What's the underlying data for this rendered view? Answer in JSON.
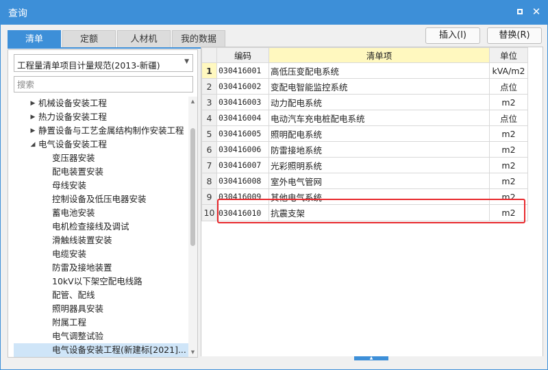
{
  "window": {
    "title": "查询"
  },
  "tabs": [
    {
      "label": "清单",
      "active": true
    },
    {
      "label": "定额",
      "active": false
    },
    {
      "label": "人材机",
      "active": false
    },
    {
      "label": "我的数据",
      "active": false
    }
  ],
  "toolbar": {
    "insert_label": "插入(I)",
    "replace_label": "替换(R)"
  },
  "left_panel": {
    "standard_select": "工程量清单项目计量规范(2013-新疆)",
    "search_placeholder": "搜索",
    "tree": [
      {
        "label": "机械设备安装工程",
        "level": 0,
        "expanded": false
      },
      {
        "label": "热力设备安装工程",
        "level": 0,
        "expanded": false
      },
      {
        "label": "静置设备与工艺金属结构制作安装工程",
        "level": 0,
        "expanded": false
      },
      {
        "label": "电气设备安装工程",
        "level": 0,
        "expanded": true
      },
      {
        "label": "变压器安装",
        "level": 1
      },
      {
        "label": "配电装置安装",
        "level": 1
      },
      {
        "label": "母线安装",
        "level": 1
      },
      {
        "label": "控制设备及低压电器安装",
        "level": 1
      },
      {
        "label": "蓄电池安装",
        "level": 1
      },
      {
        "label": "电机检查接线及调试",
        "level": 1
      },
      {
        "label": "滑触线装置安装",
        "level": 1
      },
      {
        "label": "电缆安装",
        "level": 1
      },
      {
        "label": "防雷及接地装置",
        "level": 1
      },
      {
        "label": "10kV以下架空配电线路",
        "level": 1
      },
      {
        "label": "配管、配线",
        "level": 1
      },
      {
        "label": "照明器具安装",
        "level": 1
      },
      {
        "label": "附属工程",
        "level": 1
      },
      {
        "label": "电气调整试验",
        "level": 1
      },
      {
        "label": "电气设备安装工程(新建标[2021]...",
        "level": 1,
        "selected": true
      },
      {
        "label": "建筑智能化工程",
        "level": 0,
        "expanded": false
      }
    ]
  },
  "grid": {
    "columns": [
      "编码",
      "清单项",
      "单位"
    ],
    "rows": [
      {
        "num": "1",
        "code": "030416001",
        "name": "高低压变配电系统",
        "unit": "kVA/m2",
        "current": true
      },
      {
        "num": "2",
        "code": "030416002",
        "name": "变配电智能监控系统",
        "unit": "点位"
      },
      {
        "num": "3",
        "code": "030416003",
        "name": "动力配电系统",
        "unit": "m2"
      },
      {
        "num": "4",
        "code": "030416004",
        "name": "电动汽车充电桩配电系统",
        "unit": "点位"
      },
      {
        "num": "5",
        "code": "030416005",
        "name": "照明配电系统",
        "unit": "m2"
      },
      {
        "num": "6",
        "code": "030416006",
        "name": "防雷接地系统",
        "unit": "m2"
      },
      {
        "num": "7",
        "code": "030416007",
        "name": "光彩照明系统",
        "unit": "m2"
      },
      {
        "num": "8",
        "code": "030416008",
        "name": "室外电气管网",
        "unit": "m2"
      },
      {
        "num": "9",
        "code": "030416009",
        "name": "其他电气系统",
        "unit": "m2"
      },
      {
        "num": "10",
        "code": "030416010",
        "name": "抗震支架",
        "unit": "m2"
      }
    ]
  },
  "colors": {
    "accent": "#3d8fd8",
    "highlight": "#e8262a",
    "header_yellow": "#fff8bf"
  }
}
